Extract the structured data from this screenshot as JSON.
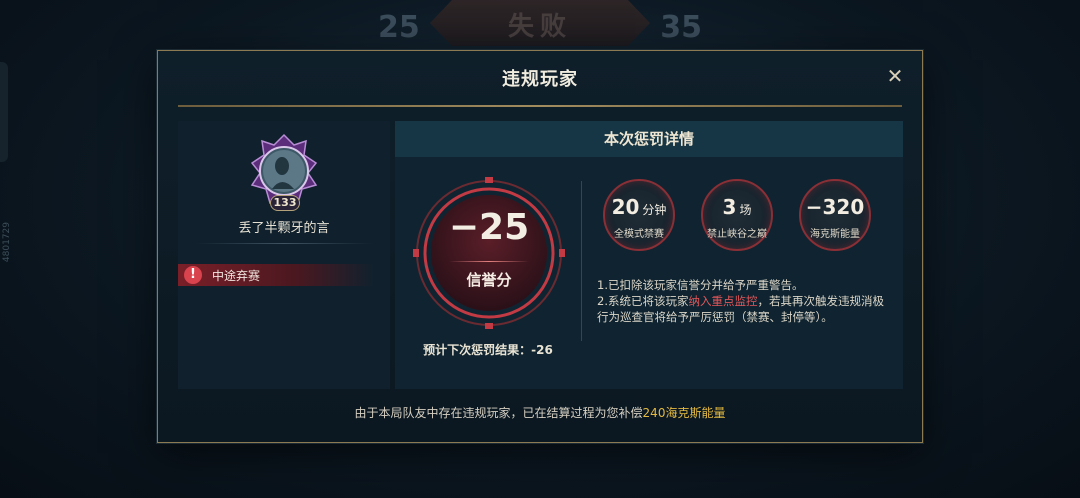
{
  "background": {
    "score_left": "25",
    "score_right": "35",
    "result": "失败",
    "side_id": "4801729"
  },
  "dialog": {
    "title": "违规玩家",
    "close_glyph": "✕"
  },
  "player": {
    "name": "丢了半颗牙的言",
    "level": "133",
    "violation": "中途弃赛"
  },
  "penalty": {
    "header": "本次惩罚详情",
    "credit_change": "−25",
    "credit_label": "信誉分",
    "next_result": "预计下次惩罚结果：-26",
    "badges": [
      {
        "value": "20",
        "unit": "分钟",
        "label": "全模式禁赛"
      },
      {
        "value": "3",
        "unit": "场",
        "label": "禁止峡谷之巅"
      },
      {
        "value": "−320",
        "unit": "",
        "label": "海克斯能量"
      }
    ],
    "note1": "1.已扣除该玩家信誉分并给予严重警告。",
    "note2_prefix": "2.系统已将该玩家",
    "note2_highlight": "纳入重点监控",
    "note2_suffix": "，若其再次触发违规消极行为巡查官将给予严厉惩罚（禁赛、封停等）。"
  },
  "footer": {
    "text_prefix": "由于本局队友中存在违规玩家，已在结算过程为您补偿",
    "text_highlight": "240海克斯能量"
  },
  "colors": {
    "gold_border": "#8c7a52",
    "penalty_red": "#c23a44",
    "highlight_red": "#e2575a",
    "gold_text": "#e3b941"
  },
  "icons": {
    "close": "close-icon",
    "warning": "warning-icon",
    "rank_frame": "rank-frame-icon"
  }
}
